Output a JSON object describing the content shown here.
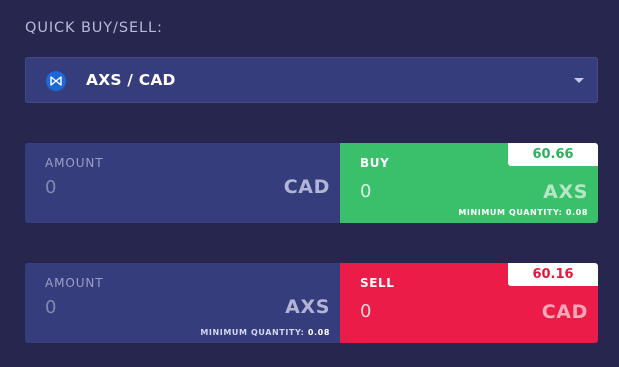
{
  "section_title": "QUICK BUY/SELL:",
  "pair_selector": {
    "label": "AXS / CAD",
    "icon": "axs-coin-icon",
    "dropdown_icon": "caret-down-icon"
  },
  "buy_row": {
    "amount_label": "AMOUNT",
    "amount_placeholder": "0",
    "amount_currency": "CAD",
    "action_label": "BUY",
    "action_placeholder": "0",
    "action_currency": "AXS",
    "price": "60.66",
    "min_qty_label": "MINIMUM QUANTITY:",
    "min_qty_value": "0.08"
  },
  "sell_row": {
    "amount_label": "AMOUNT",
    "amount_placeholder": "0",
    "amount_currency": "AXS",
    "min_qty_label": "MINIMUM QUANTITY:",
    "min_qty_value": "0.08",
    "action_label": "SELL",
    "action_placeholder": "0",
    "action_currency": "CAD",
    "price": "60.16"
  },
  "colors": {
    "background": "#27264f",
    "panel": "#363d7c",
    "buy": "#3ac06b",
    "sell": "#ec1c48",
    "coin": "#1e68d6"
  }
}
